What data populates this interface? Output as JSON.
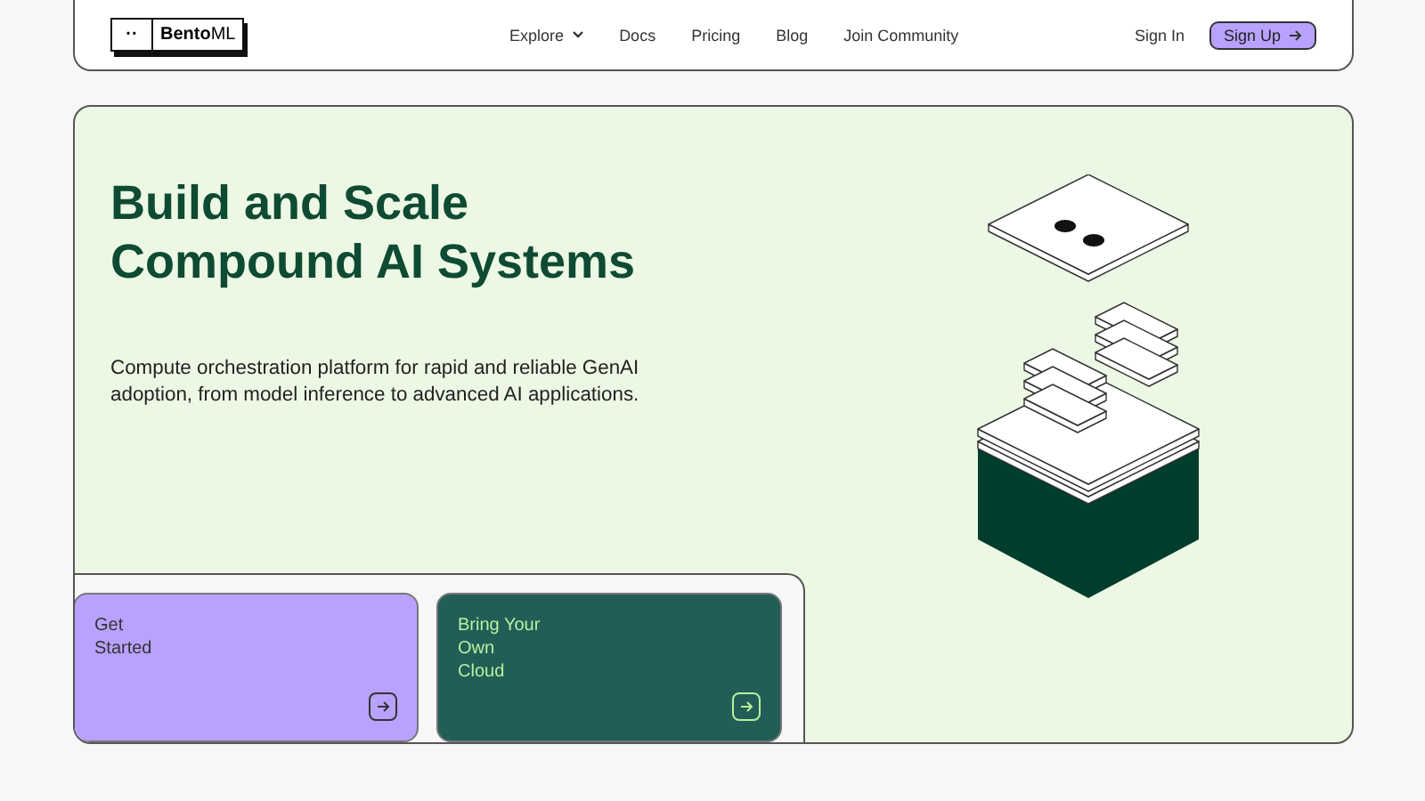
{
  "header": {
    "logo": {
      "mark": "··",
      "name_bold": "Bento",
      "name_light": "ML"
    },
    "nav": [
      {
        "label": "Explore",
        "dropdown": true
      },
      {
        "label": "Docs",
        "dropdown": false
      },
      {
        "label": "Pricing",
        "dropdown": false
      },
      {
        "label": "Blog",
        "dropdown": false
      },
      {
        "label": "Join Community",
        "dropdown": false
      }
    ],
    "sign_in": "Sign In",
    "sign_up": "Sign Up"
  },
  "hero": {
    "title_lines": [
      "Build and Scale",
      "Compound AI Systems"
    ],
    "subtitle": "Compute orchestration platform for rapid and reliable GenAI adoption, from model inference to advanced AI applications."
  },
  "cards": [
    {
      "kind": "primary",
      "lines": [
        "Get",
        "Started"
      ]
    },
    {
      "kind": "dark",
      "lines": [
        "Bring Your",
        "Own",
        "Cloud"
      ]
    }
  ]
}
